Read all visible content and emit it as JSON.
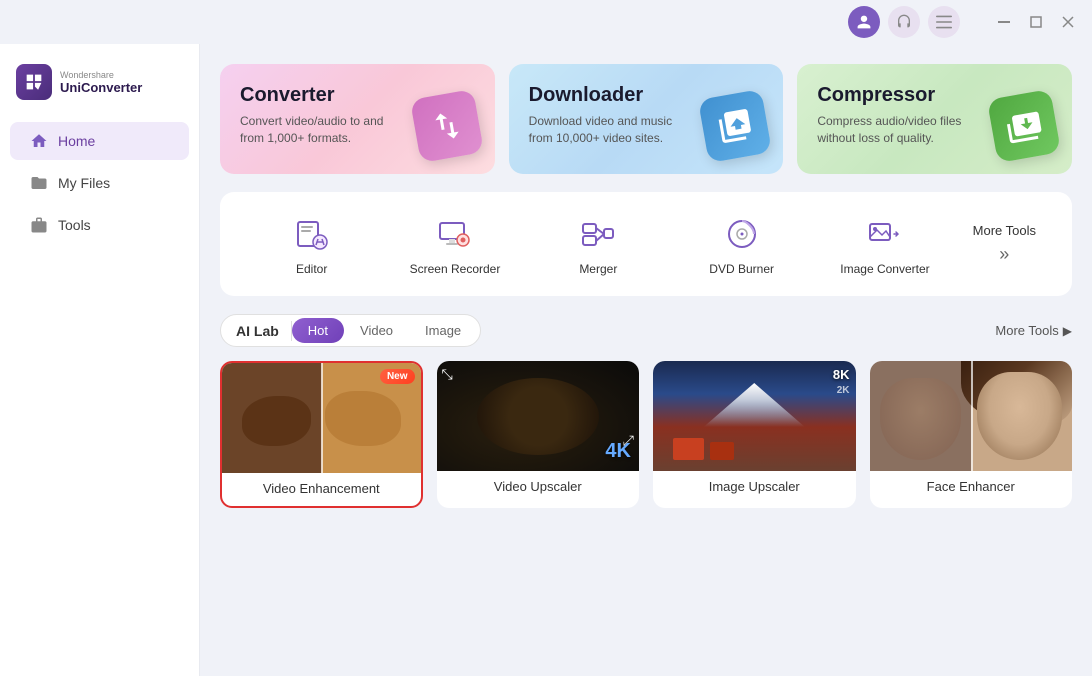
{
  "titleBar": {
    "windowControls": [
      "minimize",
      "maximize",
      "close"
    ]
  },
  "sidebar": {
    "logo": {
      "brand": "Wondershare",
      "product": "UniConverter"
    },
    "navItems": [
      {
        "id": "home",
        "label": "Home",
        "active": true
      },
      {
        "id": "myfiles",
        "label": "My Files",
        "active": false
      },
      {
        "id": "tools",
        "label": "Tools",
        "active": false
      }
    ]
  },
  "heroCards": [
    {
      "id": "converter",
      "title": "Converter",
      "description": "Convert video/audio to and from 1,000+ formats.",
      "icon": "converter-icon"
    },
    {
      "id": "downloader",
      "title": "Downloader",
      "description": "Download video and music from 10,000+ video sites.",
      "icon": "downloader-icon"
    },
    {
      "id": "compressor",
      "title": "Compressor",
      "description": "Compress audio/video files without loss of quality.",
      "icon": "compressor-icon"
    }
  ],
  "toolsBar": {
    "items": [
      {
        "id": "editor",
        "label": "Editor"
      },
      {
        "id": "screen-recorder",
        "label": "Screen Recorder"
      },
      {
        "id": "merger",
        "label": "Merger"
      },
      {
        "id": "dvd-burner",
        "label": "DVD Burner"
      },
      {
        "id": "image-converter",
        "label": "Image Converter"
      }
    ],
    "moreTools": "More Tools"
  },
  "aiLab": {
    "label": "AI Lab",
    "tabs": [
      {
        "id": "hot",
        "label": "Hot",
        "active": true
      },
      {
        "id": "video",
        "label": "Video",
        "active": false
      },
      {
        "id": "image",
        "label": "Image",
        "active": false
      }
    ],
    "moreTools": "More Tools",
    "cards": [
      {
        "id": "video-enhancement",
        "label": "Video Enhancement",
        "isNew": true,
        "selected": true,
        "newBadge": "New"
      },
      {
        "id": "video-upscaler",
        "label": "Video Upscaler",
        "isNew": false,
        "selected": false,
        "resBadge": "4K"
      },
      {
        "id": "image-upscaler",
        "label": "Image Upscaler",
        "isNew": false,
        "selected": false,
        "resBadge8k": "8K",
        "resBadge2k": "2K"
      },
      {
        "id": "face-enhancer",
        "label": "Face Enhancer",
        "isNew": false,
        "selected": false
      }
    ]
  }
}
